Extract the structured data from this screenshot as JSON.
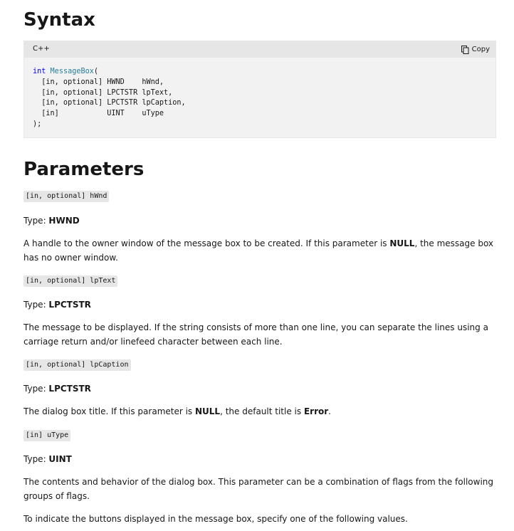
{
  "syntax": {
    "heading": "Syntax",
    "language": "C++",
    "copy_label": "Copy",
    "code": {
      "keyword": "int",
      "function": "MessageBox",
      "open": "(",
      "params": [
        "  [in, optional] HWND    hWnd,",
        "  [in, optional] LPCTSTR lpText,",
        "  [in, optional] LPCTSTR lpCaption,",
        "  [in]           UINT    uType"
      ],
      "close": ");"
    }
  },
  "parameters": {
    "heading": "Parameters",
    "items": [
      {
        "signature": "[in, optional] hWnd",
        "type_prefix": "Type: ",
        "type": "HWND",
        "desc_1": "A handle to the owner window of the message box to be created. If this parameter is ",
        "desc_bold_1": "NULL",
        "desc_2": ", the message box has no owner window."
      },
      {
        "signature": "[in, optional] lpText",
        "type_prefix": "Type: ",
        "type": "LPCTSTR",
        "desc": "The message to be displayed. If the string consists of more than one line, you can separate the lines using a carriage return and/or linefeed character between each line."
      },
      {
        "signature": "[in, optional] lpCaption",
        "type_prefix": "Type: ",
        "type": "LPCTSTR",
        "desc_1": "The dialog box title. If this parameter is ",
        "desc_bold_1": "NULL",
        "desc_2": ", the default title is ",
        "desc_bold_2": "Error",
        "desc_3": "."
      },
      {
        "signature": "[in] uType",
        "type_prefix": "Type: ",
        "type": "UINT",
        "desc": "The contents and behavior of the dialog box. This parameter can be a combination of flags from the following groups of flags."
      }
    ],
    "buttons_intro": "To indicate the buttons displayed in the message box, specify one of the following values."
  }
}
